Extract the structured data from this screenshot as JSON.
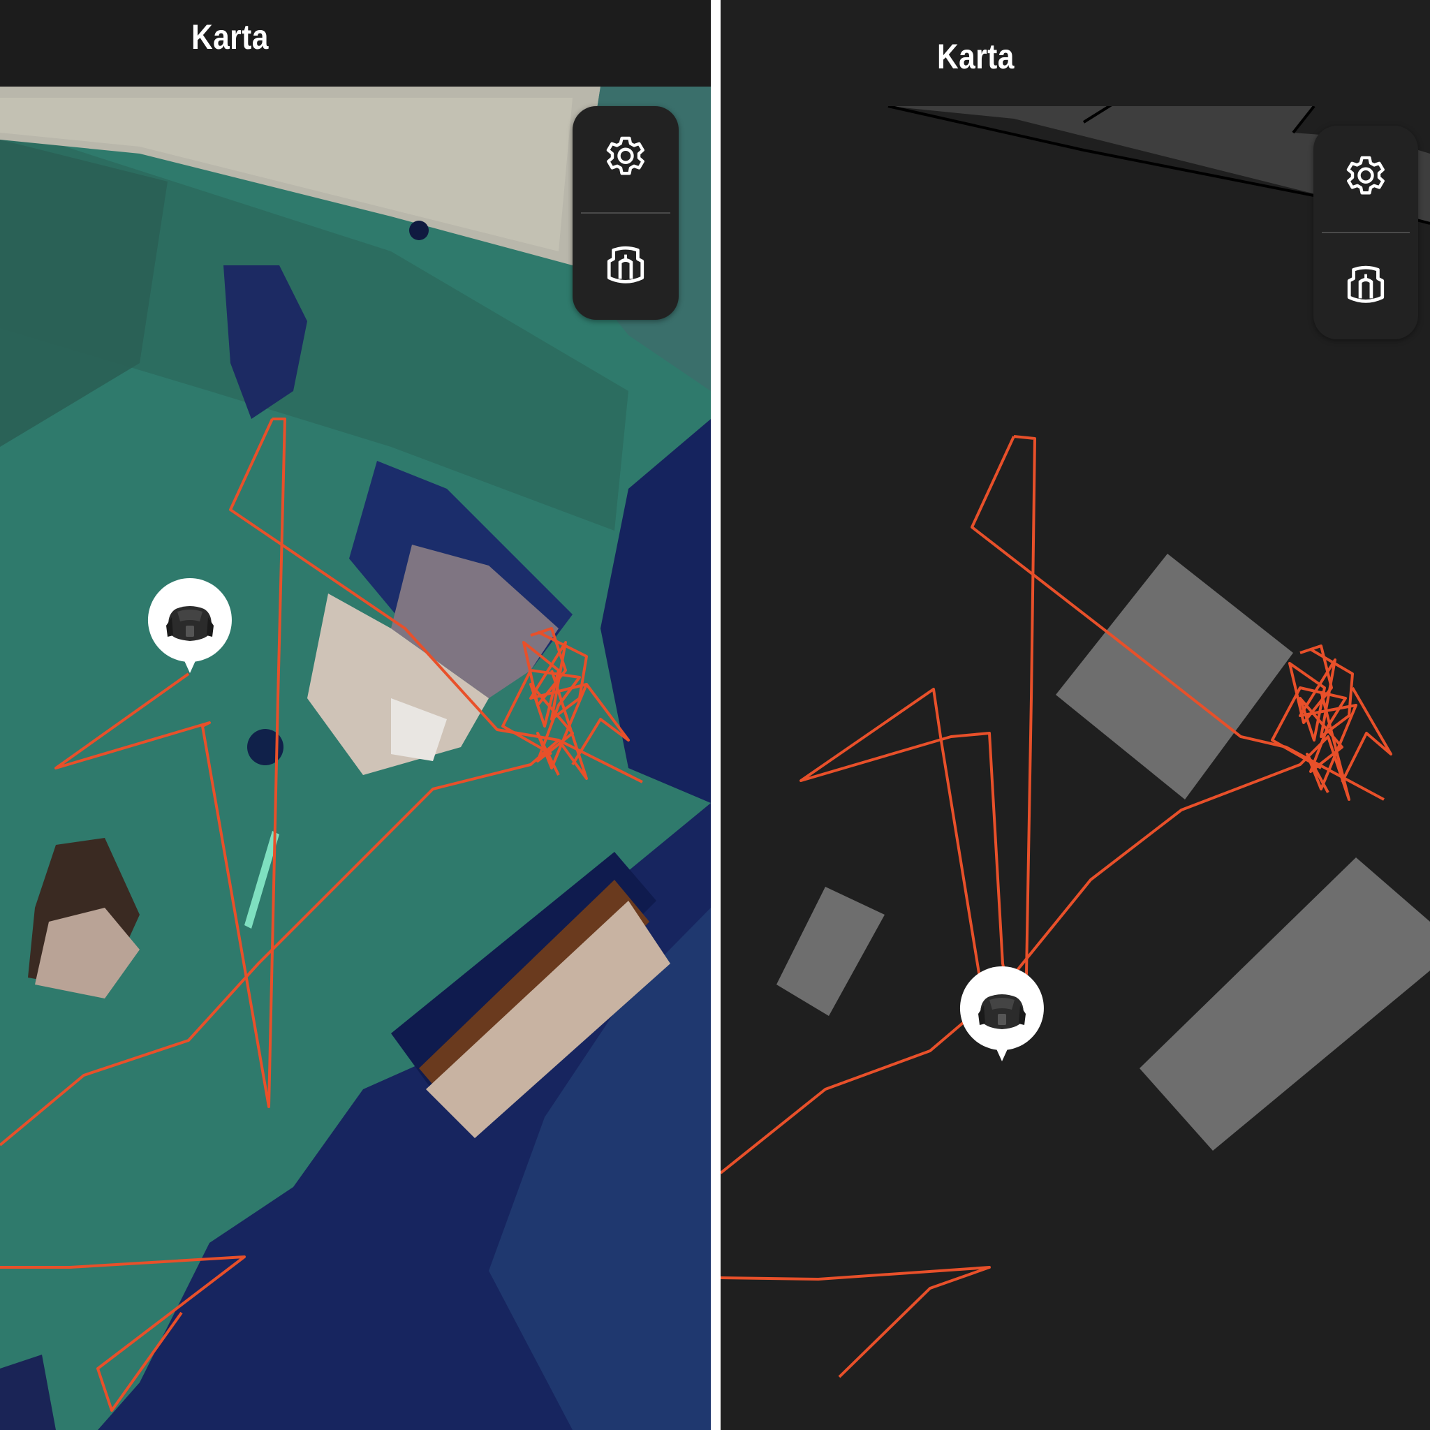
{
  "app": {
    "title": "Karta"
  },
  "left_view": {
    "title": "Karta",
    "style": "satellite",
    "controls": {
      "top_icon": "gear-icon",
      "bottom_icon": "charging-station-icon"
    },
    "mower_marker_icon": "robot-mower-icon"
  },
  "right_view": {
    "title": "Karta",
    "style": "schematic-dark",
    "controls": {
      "top_icon": "gear-icon",
      "bottom_icon": "charging-station-icon"
    },
    "mower_marker_icon": "robot-mower-icon"
  },
  "colors": {
    "path": "#e8502a",
    "topbar": "#1c1c1c",
    "dark_map_bg": "#1f1f1f",
    "building_gray": "#6e6e6e",
    "road_gray": "#3e3e3e",
    "grass": "#2f7a6c",
    "water_dark": "#15235e"
  }
}
